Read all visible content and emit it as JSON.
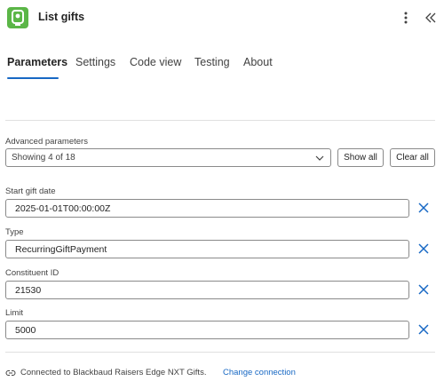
{
  "header": {
    "title": "List gifts",
    "app_icon": "lock-icon",
    "accent_color": "#5bb647"
  },
  "tabs": [
    {
      "label": "Parameters",
      "active": true
    },
    {
      "label": "Settings",
      "active": false
    },
    {
      "label": "Code view",
      "active": false
    },
    {
      "label": "Testing",
      "active": false
    },
    {
      "label": "About",
      "active": false
    }
  ],
  "advanced": {
    "label": "Advanced parameters",
    "selected": "Showing 4 of 18",
    "show_all": "Show all",
    "clear_all": "Clear all"
  },
  "fields": [
    {
      "label": "Start gift date",
      "value": "2025-01-01T00:00:00Z"
    },
    {
      "label": "Type",
      "value": "RecurringGiftPayment"
    },
    {
      "label": "Constituent ID",
      "value": "21530"
    },
    {
      "label": "Limit",
      "value": "5000"
    }
  ],
  "footer": {
    "connection_text": "Connected to Blackbaud Raisers Edge NXT Gifts.",
    "change_link": "Change connection"
  },
  "colors": {
    "link": "#1768c4",
    "tab_indicator": "#1768c4"
  }
}
